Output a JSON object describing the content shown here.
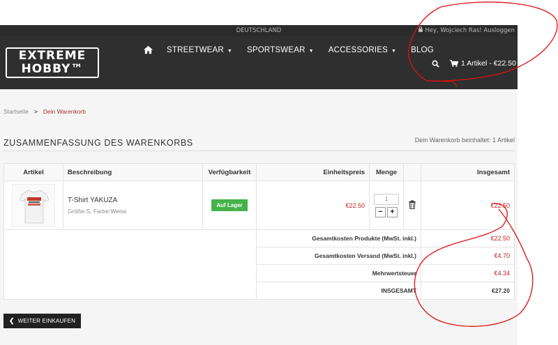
{
  "topbar": {
    "country": "DEUTSCHLAND",
    "greeting": "Hey, Wojciech Ras! Ausloggen"
  },
  "logo": {
    "line1": "EXTREME",
    "line2": "HOBBY™"
  },
  "nav": {
    "items": [
      {
        "label": "STREETWEAR",
        "has_dropdown": true
      },
      {
        "label": "SPORTSWEAR",
        "has_dropdown": true
      },
      {
        "label": "ACCESSORIES",
        "has_dropdown": true
      },
      {
        "label": "BLOG",
        "has_dropdown": false
      }
    ],
    "cart_label": "1 Artikel - €22.50"
  },
  "breadcrumb": {
    "home": "Startseite",
    "separator": ">",
    "current": "Dein Warenkorb"
  },
  "summary": {
    "title": "ZUSAMMENFASSUNG DES WARENKORBS",
    "cart_info": "Dein Warenkorb beinhaltet: 1 Artikel"
  },
  "table": {
    "headers": {
      "article": "Artikel",
      "description": "Beschreibung",
      "availability": "Verfügbarkeit",
      "unit_price": "Einheitspreis",
      "quantity": "Menge",
      "total": "Insgesamt"
    },
    "product": {
      "name": "T-Shirt YAKUZA",
      "variant": "Größe:S, Farbe:Weiss",
      "availability": "Auf Lager",
      "unit_price": "€22.50",
      "quantity": "1",
      "total": "€22.50"
    },
    "totals": [
      {
        "label": "Gesamtkosten Produkte (MwSt. inkl.)",
        "value": "€22.50"
      },
      {
        "label": "Gesamtkosten Versand (MwSt. inkl.)",
        "value": "€4.70"
      },
      {
        "label": "Mehrwertsteuer",
        "value": "€4.34"
      },
      {
        "label": "INSGESAMT",
        "value": "€27.20"
      }
    ]
  },
  "buttons": {
    "continue_shopping": "WEITER EINKAUFEN"
  },
  "colors": {
    "accent_red": "#b22222",
    "in_stock_green": "#45b24a",
    "header_dark": "#2f2f2f"
  }
}
